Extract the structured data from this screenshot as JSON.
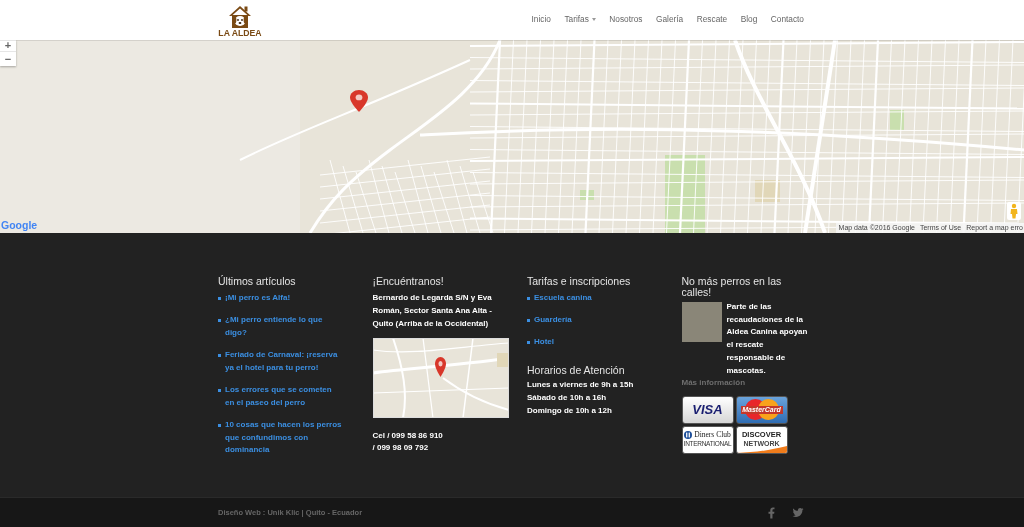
{
  "header": {
    "logo": "LA ALDEA",
    "nav": [
      {
        "label": "Inicio",
        "has_dropdown": false
      },
      {
        "label": "Tarifas",
        "has_dropdown": true
      },
      {
        "label": "Nosotros",
        "has_dropdown": false
      },
      {
        "label": "Galería",
        "has_dropdown": false
      },
      {
        "label": "Rescate",
        "has_dropdown": false
      },
      {
        "label": "Blog",
        "has_dropdown": false
      },
      {
        "label": "Contacto",
        "has_dropdown": false
      }
    ]
  },
  "map": {
    "zoom_in": "+",
    "zoom_out": "−",
    "logo": "Google",
    "map_data": "Map data ©2016 Google",
    "terms": "Terms of Use",
    "report": "Report a map erro"
  },
  "footer": {
    "latest_posts": {
      "title": "Últimos artículos",
      "items": [
        "¡Mi perro es Alfa!",
        "¿Mi perro entiende lo que digo?",
        "Feriado de Carnaval: ¡reserva ya el hotel para tu perro!",
        "Los errores que se cometen en el paseo del perro",
        "10 cosas que hacen los perros que confundimos con dominancia"
      ]
    },
    "find_us": {
      "title": "¡Encuéntranos!",
      "address": "Bernardo de Legarda S/N y Eva Román, Sector Santa Ana Alta - Quito (Arriba de la Occidental)",
      "phones": [
        "Cel / 099 58 86 910",
        "/ 099 98 09 792"
      ]
    },
    "rates": {
      "title": "Tarifas e inscripciones",
      "items": [
        "Escuela canina",
        "Guardería",
        "Hotel"
      ]
    },
    "hours": {
      "title": "Horarios de Atención",
      "lines": [
        "Lunes a viernes de 9h a 15h",
        "Sábado de 10h a 16h",
        "Domingo de 10h a 12h"
      ]
    },
    "rescue": {
      "title": "No más perros en las calles!",
      "text": "Parte de las recaudaciones de la Aldea Canina apoyan el rescate responsable de mascotas.",
      "link": "Más información",
      "cards": [
        {
          "kind": "visa",
          "label": "VISA"
        },
        {
          "kind": "mastercard",
          "label": "MasterCard"
        },
        {
          "kind": "diners",
          "label": "Diners Club",
          "sublabel": "INTERNATIONAL"
        },
        {
          "kind": "discover",
          "label": "DISCOVER",
          "sublabel": "NETWORK"
        }
      ]
    }
  },
  "bottom_bar": {
    "credit": "Diseño Web : Unik Klic | Quito - Ecuador"
  }
}
